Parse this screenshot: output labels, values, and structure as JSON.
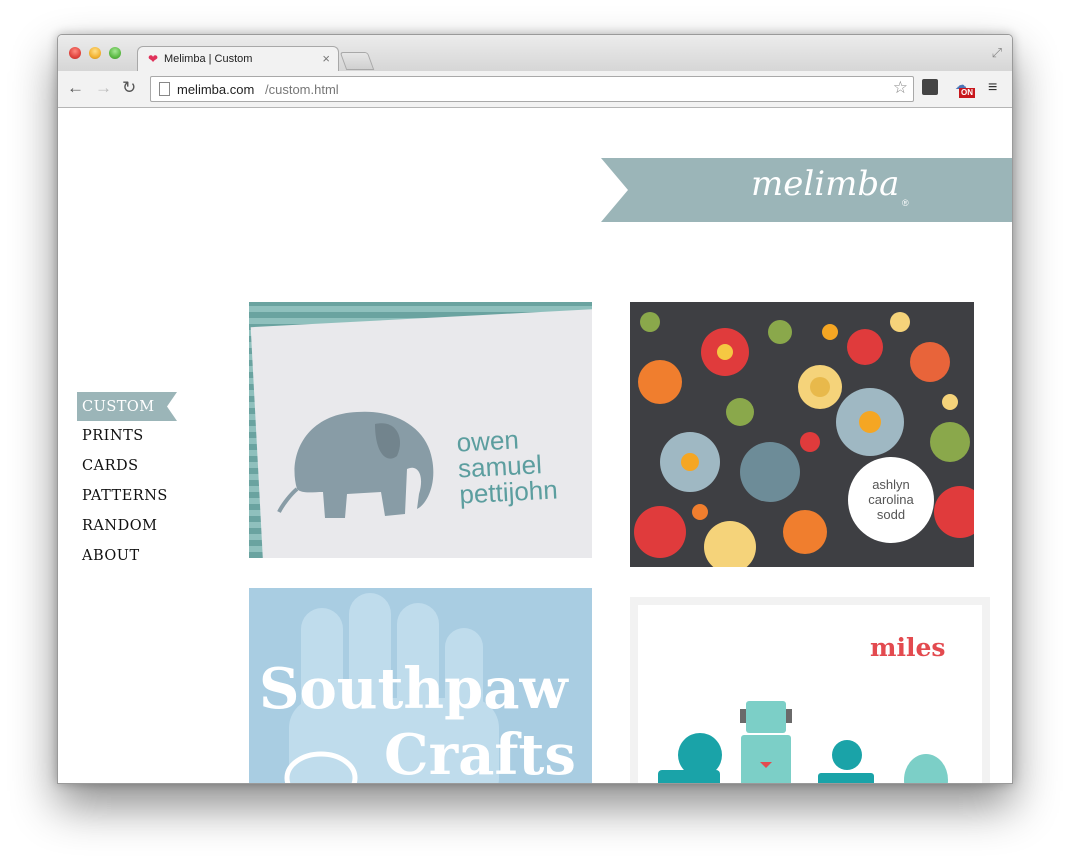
{
  "browser": {
    "tab_title": "Melimba | Custom",
    "tab_close": "×",
    "favicon": "❤",
    "url_host": "melimba.com",
    "url_path": "/custom.html",
    "back_icon": "←",
    "forward_icon": "→",
    "reload_icon": "↻",
    "star_icon": "☆",
    "menu_icon": "≡",
    "fullscreen_icon": "⤢",
    "ext_badge": "ON"
  },
  "site": {
    "logo": "melimba",
    "logo_mark": "®",
    "nav": [
      {
        "label": "CUSTOM",
        "active": true
      },
      {
        "label": "PRINTS"
      },
      {
        "label": "CARDS"
      },
      {
        "label": "PATTERNS"
      },
      {
        "label": "RANDOM"
      },
      {
        "label": "ABOUT"
      }
    ],
    "thumbs": {
      "owen": {
        "line1": "owen",
        "line2": "samuel",
        "line3": "pettijohn"
      },
      "ashlyn": {
        "line1": "ashlyn",
        "line2": "carolina",
        "line3": "sodd"
      },
      "southpaw": {
        "line1": "Southpaw",
        "line2": "Crafts"
      },
      "miles": {
        "label": "miles"
      }
    }
  },
  "colors": {
    "accent": "#9bb5b8",
    "owen_text": "#5c9e9f",
    "miles_red": "#e34a4f"
  }
}
